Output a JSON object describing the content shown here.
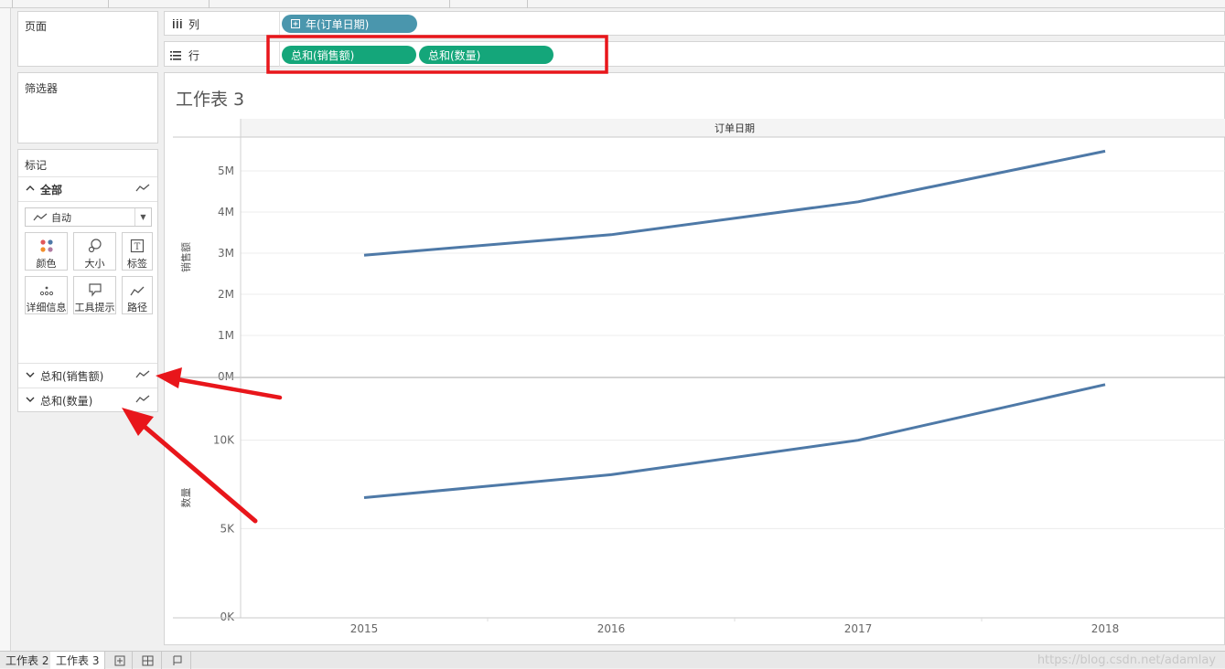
{
  "page": {
    "pages_label": "页面",
    "filters_label": "筛选器",
    "marks_label": "标记"
  },
  "marks": {
    "all_label": "全部",
    "mark_type": "自动",
    "buttons": [
      {
        "label": "颜色",
        "icon": "color-dots-icon"
      },
      {
        "label": "大小",
        "icon": "size-icon"
      },
      {
        "label": "标签",
        "icon": "label-icon"
      },
      {
        "label": "详细信息",
        "icon": "detail-icon"
      },
      {
        "label": "工具提示",
        "icon": "tooltip-icon"
      },
      {
        "label": "路径",
        "icon": "path-icon"
      }
    ],
    "measures": [
      "总和(销售额)",
      "总和(数量)"
    ]
  },
  "shelves": {
    "columns_label": "列",
    "rows_label": "行",
    "columns_pills": [
      "年(订单日期)"
    ],
    "rows_pills": [
      "总和(销售额)",
      "总和(数量)"
    ]
  },
  "worksheet": {
    "title": "工作表 3",
    "header": "订单日期"
  },
  "chart_data": [
    {
      "type": "line",
      "x": [
        "2015",
        "2016",
        "2017",
        "2018"
      ],
      "ylabel": "销售额",
      "ylim": [
        0,
        5800000
      ],
      "yticks": [
        "0M",
        "1M",
        "2M",
        "3M",
        "4M",
        "5M"
      ],
      "series": [
        {
          "values": [
            2950000,
            3450000,
            4250000,
            5480000
          ]
        }
      ],
      "color": "#4e79a7"
    },
    {
      "type": "line",
      "x": [
        "2015",
        "2016",
        "2017",
        "2018"
      ],
      "xlabel": "订单日期",
      "ylabel": "数量",
      "ylim": [
        0,
        13500
      ],
      "yticks": [
        "0K",
        "5K",
        "10K"
      ],
      "series": [
        {
          "values": [
            6750,
            8050,
            10000,
            13150
          ]
        }
      ],
      "color": "#4e79a7"
    }
  ],
  "tabs": [
    "工作表 2",
    "工作表 3"
  ],
  "watermark": "https://blog.csdn.net/adamlay",
  "annotation_colors": {
    "highlight": "#e8161b",
    "pill_green": "#14a67a",
    "pill_blue": "#4a96ad"
  }
}
